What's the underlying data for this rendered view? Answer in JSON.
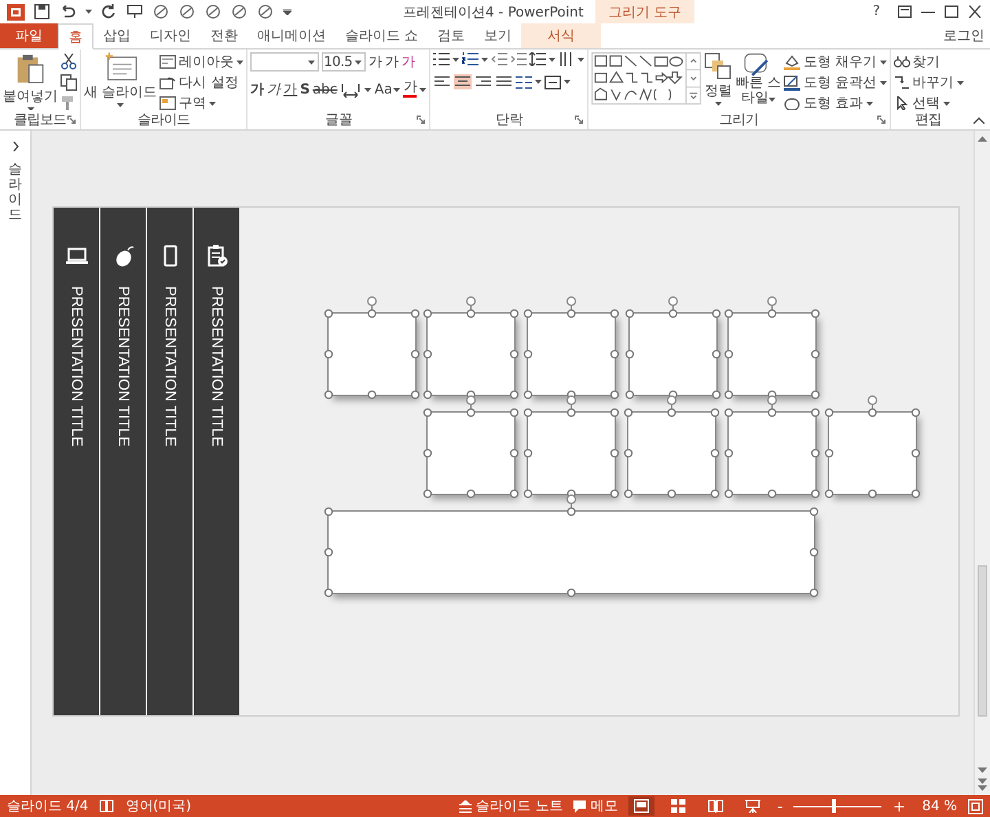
{
  "title_bar": {
    "title": "프레젠테이션4 - PowerPoint",
    "contextual_group": "그리기 도구",
    "help": "?"
  },
  "tabs": [
    {
      "label": "파일",
      "kind": "file",
      "selected": false
    },
    {
      "label": "홈",
      "kind": "tab",
      "selected": true
    },
    {
      "label": "삽입",
      "kind": "tab",
      "selected": false
    },
    {
      "label": "디자인",
      "kind": "tab",
      "selected": false
    },
    {
      "label": "전환",
      "kind": "tab",
      "selected": false
    },
    {
      "label": "애니메이션",
      "kind": "tab",
      "selected": false
    },
    {
      "label": "슬라이드 쇼",
      "kind": "tab",
      "selected": false
    },
    {
      "label": "검토",
      "kind": "tab",
      "selected": false
    },
    {
      "label": "보기",
      "kind": "tab",
      "selected": false
    },
    {
      "label": "서식",
      "kind": "contextual",
      "selected": false
    }
  ],
  "account": "로그인",
  "ribbon": {
    "clipboard": {
      "label": "클립보드",
      "paste": "붙여넣기"
    },
    "slides": {
      "label": "슬라이드",
      "new_slide": "새 슬라이드",
      "layout": "레이아웃",
      "reset": "다시 설정",
      "section": "구역"
    },
    "font": {
      "label": "글꼴",
      "font_size": "10.5",
      "grow": "가",
      "shrink": "가",
      "clear": "가",
      "bold": "가",
      "italic": "가",
      "underline": "가",
      "shadow": "S",
      "strike": "abc",
      "change_case": "Aa",
      "font_color": "가"
    },
    "paragraph": {
      "label": "단락",
      "alignment": [
        {
          "kind": "left",
          "selected": false
        },
        {
          "kind": "center",
          "selected": true
        },
        {
          "kind": "right",
          "selected": false
        },
        {
          "kind": "justify",
          "selected": false
        }
      ]
    },
    "drawing": {
      "label": "그리기",
      "arrange": "정렬",
      "quick_styles": "빠른 스타일",
      "fill": "도형 채우기",
      "outline": "도형 윤곽선",
      "effects": "도형 효과"
    },
    "editing": {
      "label": "편집",
      "find": "찾기",
      "replace": "바꾸기",
      "select": "선택"
    }
  },
  "slides_pane": {
    "label": "슬라이드"
  },
  "slide": {
    "bars": [
      {
        "title": "PRESENTATION TITLE",
        "kind": "laptop"
      },
      {
        "title": "PRESENTATION TITLE",
        "kind": "mouse"
      },
      {
        "title": "PRESENTATION TITLE",
        "kind": "phone"
      },
      {
        "title": "PRESENTATION TITLE",
        "kind": "clipboard"
      }
    ],
    "shapes": [
      {
        "kind": "square",
        "selected": true
      },
      {
        "kind": "square",
        "selected": true
      },
      {
        "kind": "square",
        "selected": true
      },
      {
        "kind": "square",
        "selected": true
      },
      {
        "kind": "square",
        "selected": true
      },
      {
        "kind": "square",
        "selected": true
      },
      {
        "kind": "square",
        "selected": true
      },
      {
        "kind": "square",
        "selected": true
      },
      {
        "kind": "square",
        "selected": true
      },
      {
        "kind": "square",
        "selected": true
      },
      {
        "kind": "wide",
        "selected": true
      }
    ]
  },
  "status_bar": {
    "slide": "슬라이드 4/4",
    "language": "영어(미국)",
    "notes": "슬라이드 노트",
    "comments": "메모",
    "views": [
      {
        "kind": "normal",
        "selected": true
      },
      {
        "kind": "sorter",
        "selected": false
      },
      {
        "kind": "reading",
        "selected": false
      },
      {
        "kind": "slideshow",
        "selected": false
      }
    ],
    "zoom": {
      "minus": "-",
      "plus": "+",
      "level": 0.45,
      "reading": "84 %"
    }
  }
}
